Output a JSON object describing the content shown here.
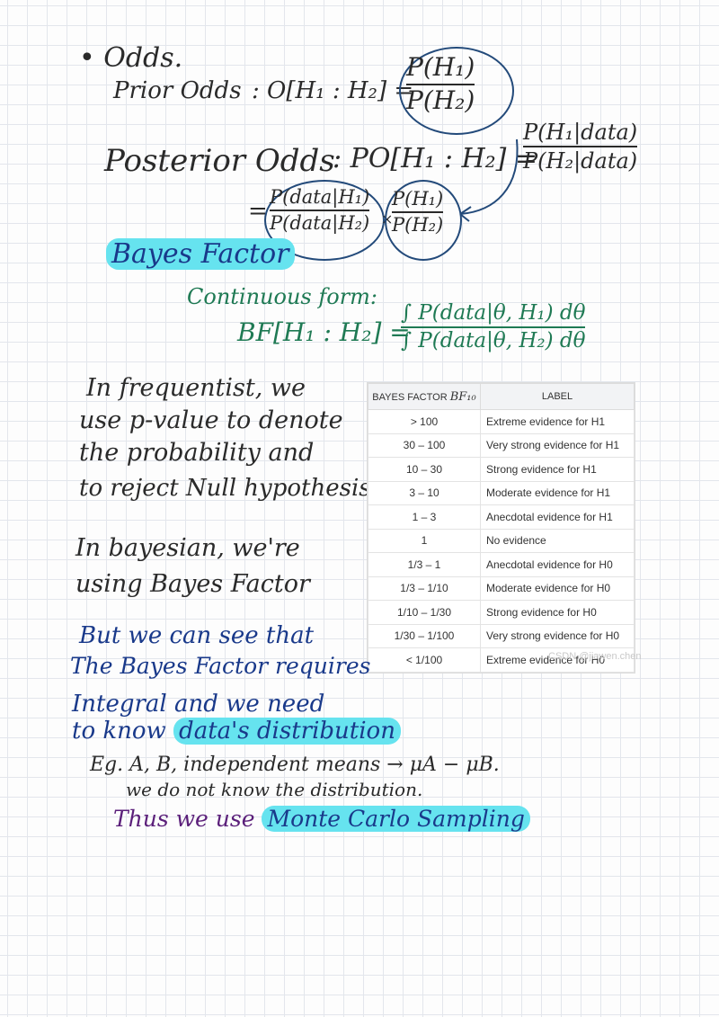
{
  "notes": {
    "odds_bullet": "• Odds.",
    "prior_odds_label": "Prior Odds",
    "prior_odds_expr": ": O[H₁ : H₂] =",
    "prior_num": "P(H₁)",
    "prior_den": "P(H₂)",
    "posterior_odds_label": "Posterior Odds",
    "posterior_odds_expr": ": PO[H₁ : H₂] =",
    "post_num": "P(H₁|data)",
    "post_den": "P(H₂|data)",
    "eq_sign": "=",
    "lik_num": "P(data|H₁)",
    "lik_den": "P(data|H₂)",
    "times": "×",
    "prior2_num": "P(H₁)",
    "prior2_den": "P(H₂)",
    "bayes_factor_title": "Bayes Factor",
    "continuous_form": "Continuous form:",
    "bf_expr": "BF[H₁ : H₂] =",
    "bf_num": "∫ P(data|θ, H₁) dθ",
    "bf_den": "∫ P(data|θ, H₂) dθ",
    "freq_1": "In frequentist, we",
    "freq_2": "use p-value to denote",
    "freq_3": "the probability and",
    "freq_4": "to reject Null hypothesis",
    "bayes_1": "In bayesian, we're",
    "bayes_2": "using Bayes Factor",
    "blue_1": "But we can see that",
    "blue_2": "The Bayes Factor requires",
    "blue_3": "Integral and we need",
    "blue_4a": "to know",
    "blue_4b": "data's distribution",
    "eg_1": "Eg. A, B, independent means → μA − μB.",
    "eg_2": "we do not know the distribution.",
    "thus_a": "Thus we use",
    "thus_b": "Monte Carlo Sampling"
  },
  "table": {
    "header_col1": "BAYES FACTOR",
    "header_col1_symbol": "BF₁₀",
    "header_col2": "LABEL",
    "rows": [
      {
        "range": "> 100",
        "label": "Extreme evidence for H1"
      },
      {
        "range": "30 – 100",
        "label": "Very strong evidence for H1"
      },
      {
        "range": "10 – 30",
        "label": "Strong evidence for H1"
      },
      {
        "range": "3 – 10",
        "label": "Moderate evidence for H1"
      },
      {
        "range": "1 – 3",
        "label": "Anecdotal evidence for H1"
      },
      {
        "range": "1",
        "label": "No evidence"
      },
      {
        "range": "1/3 – 1",
        "label": "Anecdotal evidence for H0"
      },
      {
        "range": "1/3 – 1/10",
        "label": "Moderate evidence for H0"
      },
      {
        "range": "1/10 – 1/30",
        "label": "Strong evidence for H0"
      },
      {
        "range": "1/30 – 1/100",
        "label": "Very strong evidence for H0"
      },
      {
        "range": "< 1/100",
        "label": "Extreme evidence for H0"
      }
    ]
  },
  "watermark": "CSDN @jiawen.chen",
  "colors": {
    "ink_black": "#2a2a2a",
    "ink_green": "#1f7a54",
    "ink_blue": "#19398a",
    "ink_purple": "#5b1f7a",
    "highlight": "#66e3ef",
    "circle": "#234a7a"
  }
}
